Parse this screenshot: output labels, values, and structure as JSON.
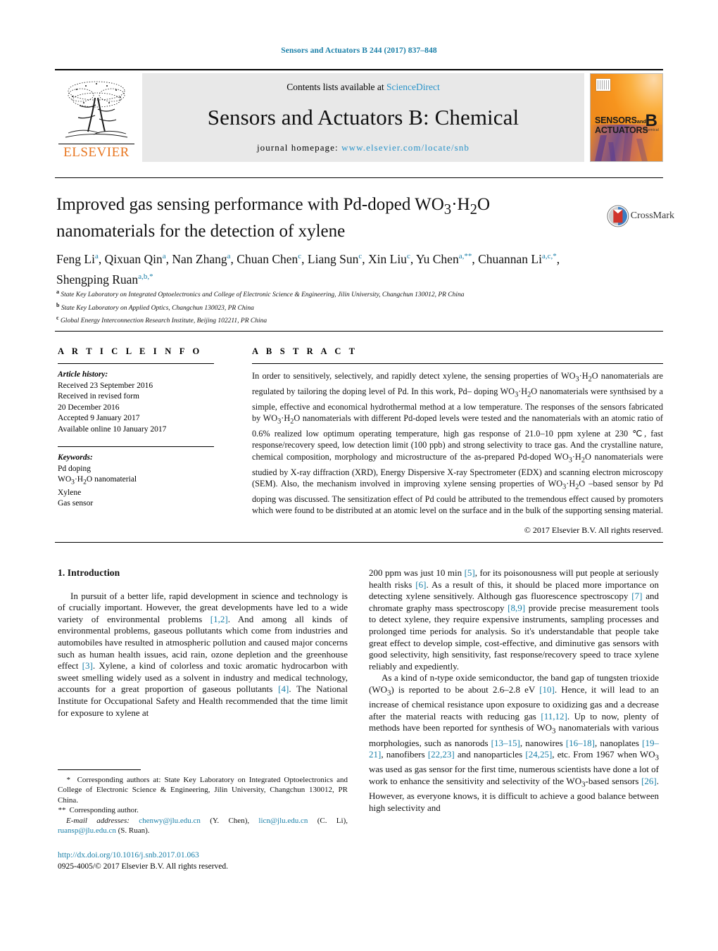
{
  "running_head": "Sensors and Actuators B 244 (2017) 837–848",
  "masthead": {
    "contents_prefix": "Contents lists available at ",
    "contents_link": "ScienceDirect",
    "journal_name": "Sensors and Actuators B: Chemical",
    "homepage_prefix": "journal homepage: ",
    "homepage_url": "www.elsevier.com/locate/snb",
    "publisher": "ELSEVIER",
    "cover": {
      "title_line1": "SENSORS",
      "title_and": "and",
      "title_line2": "ACTUATORS",
      "volume_letter": "B",
      "volume_sub": "Chemical"
    }
  },
  "article": {
    "title": "Improved gas sensing performance with Pd-doped WO3·H2O nanomaterials for the detection of xylene",
    "title_html": "Improved gas sensing performance with Pd-doped WO<sub>3</sub>·H<sub>2</sub>O nanomaterials for the detection of xylene",
    "crossmark_label": "CrossMark",
    "authors_html": "Feng Li<sup>a</sup>, Qixuan Qin<sup>a</sup>, Nan Zhang<sup>a</sup>, Chuan Chen<sup>c</sup>, Liang Sun<sup>c</sup>, Xin Liu<sup>c</sup>, Yu Chen<sup>a,**</sup>, Chuannan Li<sup>a,c,*</sup>, Shengping Ruan<sup>a,b,*</sup>",
    "affiliations": [
      "State Key Laboratory on Integrated Optoelectronics and College of Electronic Science & Engineering, Jilin University, Changchun 130012, PR China",
      "State Key Laboratory on Applied Optics, Changchun 130023, PR China",
      "Global Energy Interconnection Research Institute, Beijing 102211, PR China"
    ],
    "affiliation_marks": [
      "a",
      "b",
      "c"
    ]
  },
  "info": {
    "heading": "A R T I C L E   I N F O",
    "history_label": "Article history:",
    "history": [
      "Received 23 September 2016",
      "Received in revised form",
      "20 December 2016",
      "Accepted 9 January 2017",
      "Available online 10 January 2017"
    ],
    "keywords_label": "Keywords:",
    "keywords_html": "Pd doping<br>WO<sub>3</sub>·H<sub>2</sub>O nanomaterial<br>Xylene<br>Gas sensor",
    "keywords": [
      "Pd doping",
      "WO3·H2O nanomaterial",
      "Xylene",
      "Gas sensor"
    ]
  },
  "abstract": {
    "heading": "A B S T R A C T",
    "text_html": "In order to sensitively, selectively, and rapidly detect xylene, the sensing properties of WO<sub>3</sub>·H<sub>2</sub>O nanomaterials are regulated by tailoring the doping level of Pd. In this work, Pd– doping WO<sub>3</sub>·H<sub>2</sub>O nanomaterials were synthsised by a simple, effective and economical hydrothermal method at a low temperature. The responses of the sensors fabricated by WO<sub>3</sub>·H<sub>2</sub>O nanomaterials with different Pd-doped levels were tested and the nanomaterials with an atomic ratio of 0.6% realized low optimum operating temperature, high gas response of 21.0–10 ppm xylene at 230 &#8451;, fast response/recovery speed, low detection limit (100 ppb) and strong selectivity to trace gas. And the crystalline nature, chemical composition, morphology and microstructure of the as-prepared Pd-doped WO<sub>3</sub>·H<sub>2</sub>O nanomaterials were studied by X-ray diffraction (XRD), Energy Dispersive X-ray Spectrometer (EDX) and scanning electron microscopy (SEM). Also, the mechanism involved in improving xylene sensing properties of WO<sub>3</sub>·H<sub>2</sub>O –based sensor by Pd doping was discussed. The sensitization effect of Pd could be attributed to the tremendous effect caused by promoters which were found to be distributed at an atomic level on the surface and in the bulk of the supporting sensing material.",
    "copyright": "© 2017 Elsevier B.V. All rights reserved."
  },
  "body": {
    "section_number_title": "1.  Introduction",
    "left_paragraph_html": "In pursuit of a better life, rapid development in science and technology is of crucially important. However, the great developments have led to a wide variety of environmental problems <span class=\"cite\">[1,2]</span>. And among all kinds of environmental problems, gaseous pollutants which come from industries and automobiles have resulted in atmospheric pollution and caused major concerns such as human health issues, acid rain, ozone depletion and the greenhouse effect <span class=\"cite\">[3]</span>. Xylene, a kind of colorless and toxic aromatic hydrocarbon with sweet smelling widely used as a solvent in industry and medical technology, accounts for a great proportion of gaseous pollutants <span class=\"cite\">[4]</span>. The National Institute for Occupational Safety and Health recommended that the time limit for exposure to xylene at",
    "right_paragraph1_html": "200 ppm was just 10 min <span class=\"cite\">[5]</span>, for its poisonousness will put people at seriously health risks <span class=\"cite\">[6]</span>. As a result of this, it should be placed more importance on detecting xylene sensitively. Although gas fluorescence spectroscopy <span class=\"cite\">[7]</span> and chromate graphy mass spectroscopy <span class=\"cite\">[8,9]</span> provide precise measurement tools to detect xylene, they require expensive instruments, sampling processes and prolonged time periods for analysis. So it's understandable that people take great effect to develop simple, cost-effective, and diminutive gas sensors with good selectivity, high sensitivity, fast response/recovery speed to trace xylene reliably and expediently.",
    "right_paragraph2_html": "As a kind of n-type oxide semiconductor, the band gap of tungsten trioxide (WO<sub>3</sub>) is reported to be about 2.6–2.8 eV <span class=\"cite\">[10]</span>. Hence, it will lead to an increase of chemical resistance upon exposure to oxidizing gas and a decrease after the material reacts with reducing gas <span class=\"cite\">[11,12]</span>. Up to now, plenty of methods have been reported for synthesis of WO<sub>3</sub> nanomaterials with various morphologies, such as nanorods <span class=\"cite\">[13–15]</span>, nanowires <span class=\"cite\">[16–18]</span>, nanoplates <span class=\"cite\">[19–21]</span>, nanofibers <span class=\"cite\">[22,23]</span> and nanoparticles <span class=\"cite\">[24,25]</span>, etc. From 1967 when WO<sub>3</sub> was used as gas sensor for the first time, numerous scientists have done a lot of work to enhance the sensitivity and selectivity of the WO<sub>3</sub>-based sensors <span class=\"cite\">[26]</span>. However, as everyone knows, it is difficult to achieve a good balance between high selectivity and"
  },
  "footnotes": {
    "corresponding_html": "<span class=\"em\">*</span>&nbsp; Corresponding authors at: State Key Laboratory on Integrated Optoelectronics and College of Electronic Science &amp; Engineering, Jilin University, Changchun 130012, PR China.",
    "corresponding2_html": "<span class=\"em\">**</span>&nbsp; Corresponding author.",
    "emails_html": "<span class=\"em\">E-mail addresses:</span> <span class=\"lnk\">chenwy@jlu.edu.cn</span> (Y. Chen), <span class=\"lnk\">licn@jlu.edu.cn</span> (C. Li), <span class=\"lnk\">ruansp@jlu.edu.cn</span> (S. Ruan).",
    "emails": [
      "chenwy@jlu.edu.cn",
      "licn@jlu.edu.cn",
      "ruansp@jlu.edu.cn"
    ]
  },
  "footer": {
    "doi": "http://dx.doi.org/10.1016/j.snb.2017.01.063",
    "issn_line": "0925-4005/© 2017 Elsevier B.V. All rights reserved."
  },
  "colors": {
    "link_blue": "#1a7fa8",
    "sciencedirect_blue": "#2a93c9",
    "elsevier_orange": "#E87722",
    "banner_gray": "#e8e8e8"
  }
}
